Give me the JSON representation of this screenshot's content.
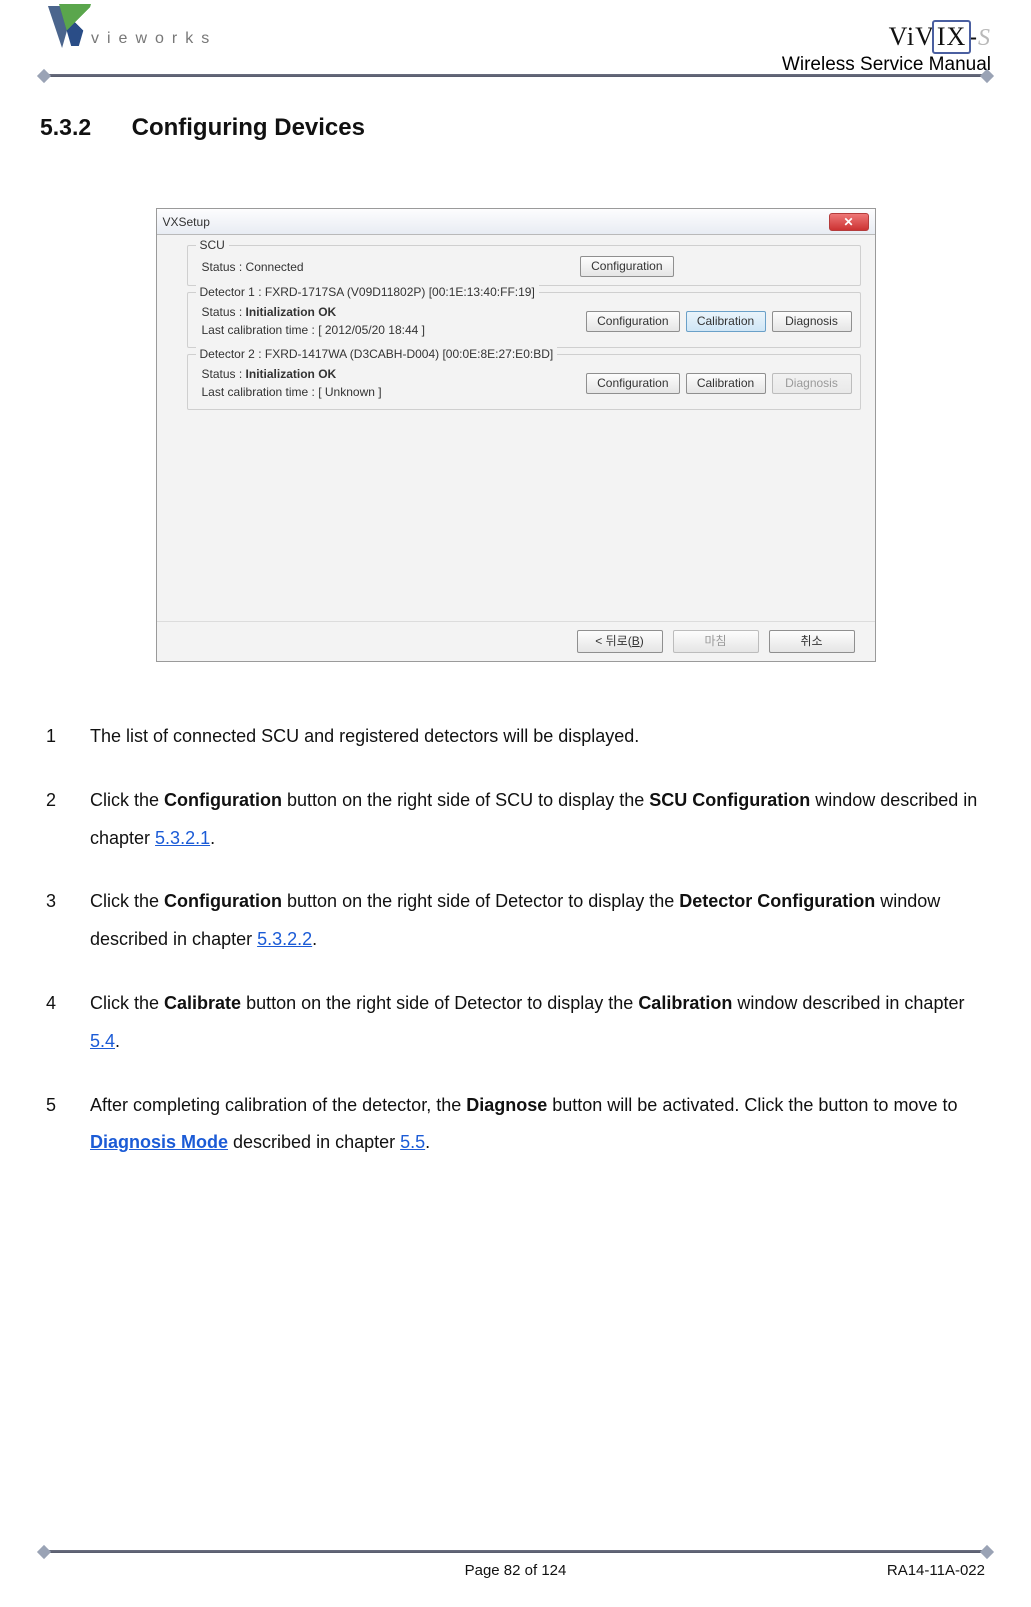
{
  "brand_word": "vieworks",
  "product_logo": {
    "part_a": "ViV",
    "part_ix": "IX",
    "part_dash": "-",
    "part_s": "S"
  },
  "doc_title": "Wireless Service Manual",
  "section": {
    "number": "5.3.2",
    "title": "Configuring Devices"
  },
  "window": {
    "title": "VXSetup",
    "close_label": "✕",
    "scu": {
      "legend": "SCU",
      "status_line": "Status  :  Connected",
      "buttons": {
        "config": "Configuration"
      }
    },
    "detectors": [
      {
        "legend": "Detector 1 : FXRD-1717SA (V09D11802P) [00:1E:13:40:FF:19]",
        "status_label": "Status : ",
        "status_value": "Initialization OK",
        "calib_line": "Last calibration time  :  [  2012/05/20 18:44  ]",
        "buttons": {
          "config": "Configuration",
          "calib": "Calibration",
          "diag": "Diagnosis"
        },
        "calib_selected": true,
        "diag_enabled": true
      },
      {
        "legend": "Detector 2 : FXRD-1417WA (D3CABH-D004) [00:0E:8E:27:E0:BD]",
        "status_label": "Status : ",
        "status_value": "Initialization OK",
        "calib_line": "Last calibration time  :  [  Unknown  ]",
        "buttons": {
          "config": "Configuration",
          "calib": "Calibration",
          "diag": "Diagnosis"
        },
        "calib_selected": false,
        "diag_enabled": false
      }
    ],
    "footer_buttons": {
      "back_pre": "< 뒤로(",
      "back_u": "B",
      "back_post": ")",
      "finish": "마침",
      "cancel": "취소"
    }
  },
  "steps": [
    {
      "n": "1",
      "parts": [
        {
          "t": "The list of connected SCU and registered detectors will be displayed."
        }
      ]
    },
    {
      "n": "2",
      "parts": [
        {
          "t": "Click the "
        },
        {
          "b": "Configuration"
        },
        {
          "t": " button on the right side of SCU to display the "
        },
        {
          "b": "SCU Configuration"
        },
        {
          "t": " window described in chapter "
        },
        {
          "a": "5.3.2.1"
        },
        {
          "t": "."
        }
      ]
    },
    {
      "n": "3",
      "parts": [
        {
          "t": "Click the "
        },
        {
          "b": "Configuration"
        },
        {
          "t": " button on the right side of Detector to display the "
        },
        {
          "b": "Detector Configuration"
        },
        {
          "t": " window described in chapter "
        },
        {
          "a": "5.3.2.2"
        },
        {
          "t": "."
        }
      ]
    },
    {
      "n": "4",
      "parts": [
        {
          "t": "Click the "
        },
        {
          "b": "Calibrate"
        },
        {
          "t": " button on the right side of Detector to display the "
        },
        {
          "b": "Calibration"
        },
        {
          "t": " window described in chapter "
        },
        {
          "a": "5.4"
        },
        {
          "t": "."
        }
      ]
    },
    {
      "n": "5",
      "parts": [
        {
          "t": "After completing calibration of the detector, the "
        },
        {
          "b": "Diagnose"
        },
        {
          "t": " button will be activated. Click the button to move to "
        },
        {
          "ab": "Diagnosis Mode"
        },
        {
          "t": " described in chapter "
        },
        {
          "a": "5.5"
        },
        {
          "t": "."
        }
      ]
    }
  ],
  "footer": {
    "page": "Page 82 of 124",
    "code": "RA14-11A-022"
  }
}
